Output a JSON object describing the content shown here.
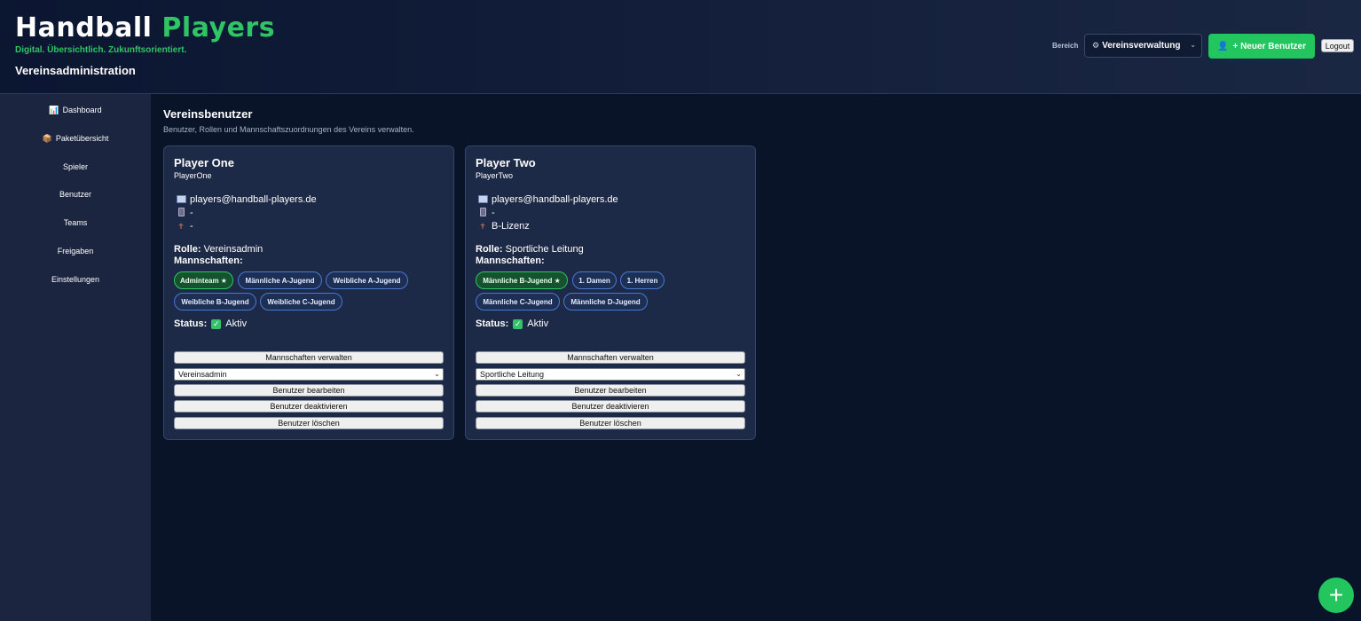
{
  "header": {
    "brand_word1": "Handball",
    "brand_word2": "Players",
    "tagline": "Digital. Übersichtlich. Zukunftsorientiert.",
    "subtitle": "Vereinsadministration",
    "area_label": "Bereich",
    "area_selected": "Vereinsverwaltung",
    "new_user_button": "+ Neuer Benutzer",
    "logout_button": "Logout"
  },
  "sidebar": {
    "items": [
      {
        "label": "Dashboard",
        "icon": "📊"
      },
      {
        "label": "Paketübersicht",
        "icon": "📦"
      },
      {
        "label": "Spieler"
      },
      {
        "label": "Benutzer"
      },
      {
        "label": "Teams"
      },
      {
        "label": "Freigaben"
      },
      {
        "label": "Einstellungen"
      }
    ]
  },
  "main": {
    "title": "Vereinsbenutzer",
    "subtitle": "Benutzer, Rollen und Mannschaftszuordnungen des Vereins verwalten."
  },
  "cards": [
    {
      "name": "Player One",
      "username": "PlayerOne",
      "email": "players@handball-players.de",
      "phone": "-",
      "license": "-",
      "role_label": "Rolle:",
      "role": "Vereinsadmin",
      "teams_label": "Mannschaften:",
      "teams": [
        "Adminteam ★",
        "Männliche A-Jugend",
        "Weibliche A-Jugend",
        "Weibliche B-Jugend",
        "Weibliche C-Jugend"
      ],
      "status_label": "Status:",
      "status": "Aktiv",
      "btn_manage_teams": "Mannschaften verwalten",
      "role_select": "Vereinsadmin",
      "btn_edit": "Benutzer bearbeiten",
      "btn_deactivate": "Benutzer deaktivieren",
      "btn_delete": "Benutzer löschen"
    },
    {
      "name": "Player Two",
      "username": "PlayerTwo",
      "email": "players@handball-players.de",
      "phone": "-",
      "license": "B-Lizenz",
      "role_label": "Rolle:",
      "role": "Sportliche Leitung",
      "teams_label": "Mannschaften:",
      "teams": [
        "Männliche B-Jugend ★",
        "1. Damen",
        "1. Herren",
        "Männliche C-Jugend",
        "Männliche D-Jugend"
      ],
      "status_label": "Status:",
      "status": "Aktiv",
      "btn_manage_teams": "Mannschaften verwalten",
      "role_select": "Sportliche Leitung",
      "btn_edit": "Benutzer bearbeiten",
      "btn_deactivate": "Benutzer deaktivieren",
      "btn_delete": "Benutzer löschen"
    }
  ],
  "fab_label": "+",
  "colors": {
    "accent": "#22c55e",
    "background": "#0a1428",
    "sidebar": "#1b2540",
    "card": "#1d2a47"
  }
}
